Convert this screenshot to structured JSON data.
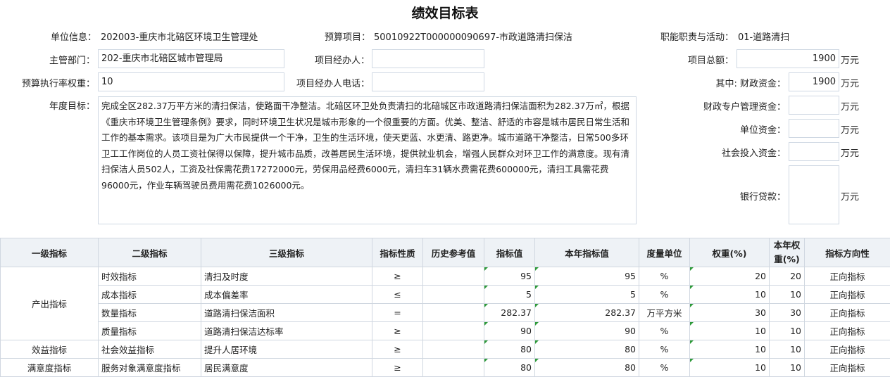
{
  "title": "绩效目标表",
  "info": {
    "unit_label": "单位信息：",
    "unit_value": "202003-重庆市北碚区环境卫生管理处",
    "project_label": "预算项目：",
    "project_value": "50010922T000000090697-市政道路清扫保洁",
    "duty_label": "职能职责与活动：",
    "duty_value": "01-道路清扫"
  },
  "form": {
    "dept_label": "主管部门：",
    "dept_value": "202-重庆市北碚区城市管理局",
    "manager_label": "项目经办人：",
    "manager_value": "",
    "weight_label": "预算执行率权重：",
    "weight_value": "10",
    "phone_label": "项目经办人电话：",
    "phone_value": "",
    "goal_label": "年度目标：",
    "goal_text": "完成全区282.37万平方米的清扫保洁，使路面干净整洁。北碚区环卫处负责清扫的北碚城区市政道路清扫保洁面积为282.37万㎡，根据《重庆市环境卫生管理条例》要求，同时环境卫生状况是城市形象的一个很重要的方面。优美、整洁、舒适的市容是城市居民日常生活和工作的基本需求。该项目是为广大市民提供一个干净，卫生的生活环境，使天更蓝、水更清、路更净。城市道路干净整洁，日常500多环卫工工作岗位的人员工资社保得以保障，提升城市品质，改善居民生活环境，提供就业机会，增强人民群众对环卫工作的满意度。现有清扫保洁人员502人，工资及社保需花费17272000元，劳保用品经费6000元，清扫车31辆水费需花费600000元，清扫工具需花费96000元，作业车辆驾驶员费用需花费1026000元。"
  },
  "funds": {
    "unit": "万元",
    "total_label": "项目总额：",
    "total_value": "1900",
    "fiscal_label": "其中:  财政资金：",
    "fiscal_value": "1900",
    "special_label": "财政专户管理资金：",
    "special_value": "",
    "unit_funds_label": "单位资金：",
    "unit_funds_value": "",
    "social_label": "社会投入资金：",
    "social_value": "",
    "bank_label": "银行贷款：",
    "bank_value": ""
  },
  "table": {
    "headers": [
      "一级指标",
      "二级指标",
      "三级指标",
      "指标性质",
      "历史参考值",
      "指标值",
      "本年指标值",
      "度量单位",
      "权重(%)",
      "本年权重(%)",
      "指标方向性"
    ],
    "groups": [
      "产出指标",
      "效益指标",
      "满意度指标"
    ],
    "rows": [
      {
        "l2": "时效指标",
        "l3": "清扫及时度",
        "nature": "≥",
        "hist": "",
        "value": "95",
        "year_value": "95",
        "unit": "%",
        "weight": "20",
        "year_weight": "20",
        "direction": "正向指标"
      },
      {
        "l2": "成本指标",
        "l3": "成本偏差率",
        "nature": "≤",
        "hist": "",
        "value": "5",
        "year_value": "5",
        "unit": "%",
        "weight": "10",
        "year_weight": "10",
        "direction": "正向指标"
      },
      {
        "l2": "数量指标",
        "l3": "道路清扫保洁面积",
        "nature": "=",
        "hist": "",
        "value": "282.37",
        "year_value": "282.37",
        "unit": "万平方米",
        "weight": "30",
        "year_weight": "30",
        "direction": "正向指标"
      },
      {
        "l2": "质量指标",
        "l3": "道路清扫保洁达标率",
        "nature": "≥",
        "hist": "",
        "value": "90",
        "year_value": "90",
        "unit": "%",
        "weight": "10",
        "year_weight": "10",
        "direction": "正向指标"
      },
      {
        "l2": "社会效益指标",
        "l3": "提升人居环境",
        "nature": "≥",
        "hist": "",
        "value": "80",
        "year_value": "80",
        "unit": "%",
        "weight": "10",
        "year_weight": "10",
        "direction": "正向指标"
      },
      {
        "l2": "服务对象满意度指标",
        "l3": "居民满意度",
        "nature": "≥",
        "hist": "",
        "value": "80",
        "year_value": "80",
        "unit": "%",
        "weight": "10",
        "year_weight": "10",
        "direction": "正向指标"
      }
    ]
  }
}
